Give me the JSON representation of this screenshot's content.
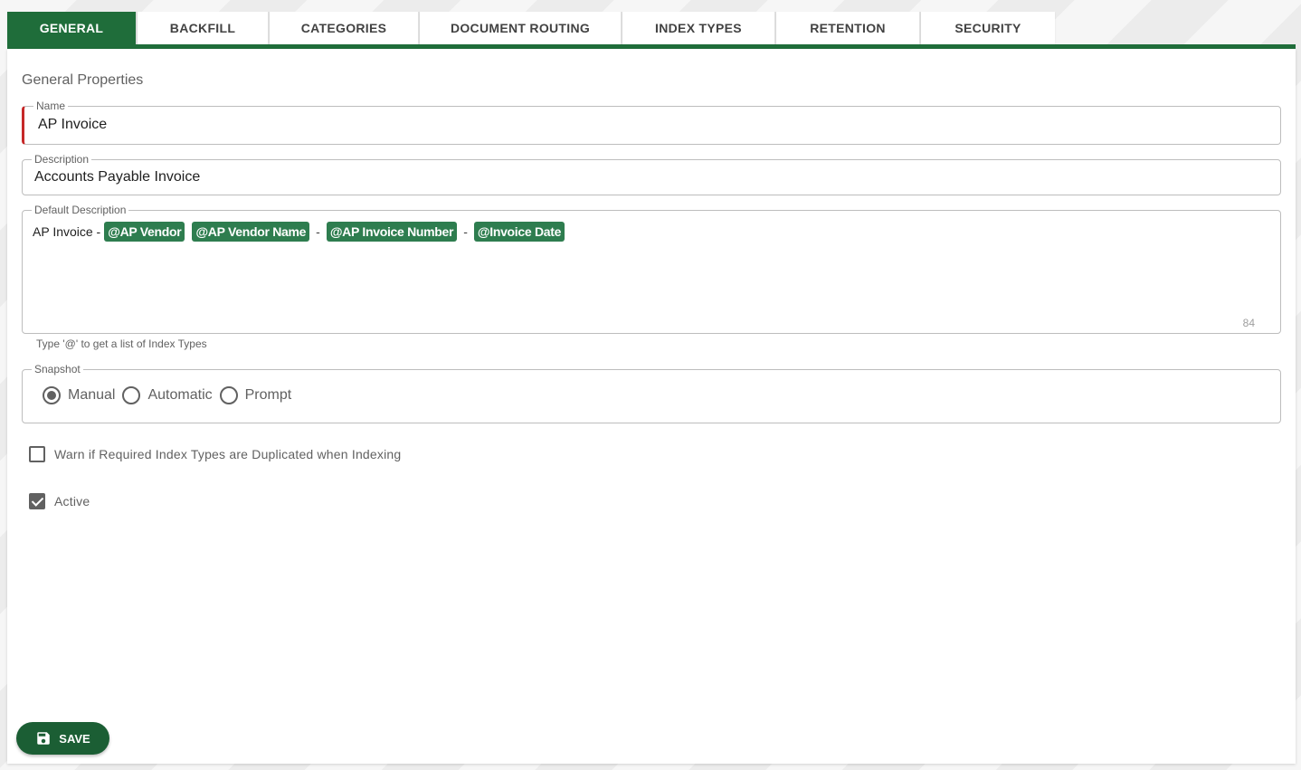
{
  "tabs": [
    {
      "label": "GENERAL",
      "active": true
    },
    {
      "label": "BACKFILL",
      "active": false
    },
    {
      "label": "CATEGORIES",
      "active": false
    },
    {
      "label": "DOCUMENT ROUTING",
      "active": false
    },
    {
      "label": "INDEX TYPES",
      "active": false
    },
    {
      "label": "RETENTION",
      "active": false
    },
    {
      "label": "SECURITY",
      "active": false
    }
  ],
  "section": {
    "title": "General Properties"
  },
  "name_field": {
    "label": "Name",
    "value": "AP Invoice"
  },
  "description_field": {
    "label": "Description",
    "value": "Accounts Payable Invoice"
  },
  "default_description": {
    "label": "Default Description",
    "prefix": "AP Invoice -",
    "chips": [
      "@AP Vendor",
      "@AP Vendor Name",
      "@AP Invoice Number",
      "@Invoice Date"
    ],
    "separator": "-",
    "counter": "84",
    "hint": "Type '@' to get a list of Index Types"
  },
  "snapshot": {
    "label": "Snapshot",
    "options": [
      {
        "label": "Manual",
        "selected": true
      },
      {
        "label": "Automatic",
        "selected": false
      },
      {
        "label": "Prompt",
        "selected": false
      }
    ]
  },
  "checks": {
    "warn_label": "Warn if Required Index Types are Duplicated when Indexing",
    "warn_checked": false,
    "active_label": "Active",
    "active_checked": true
  },
  "save_button": {
    "label": "SAVE",
    "icon": "floppy-disk-icon"
  },
  "colors": {
    "accent": "#1f6d3a",
    "chip": "#2e7d4f",
    "error": "#c62828"
  }
}
